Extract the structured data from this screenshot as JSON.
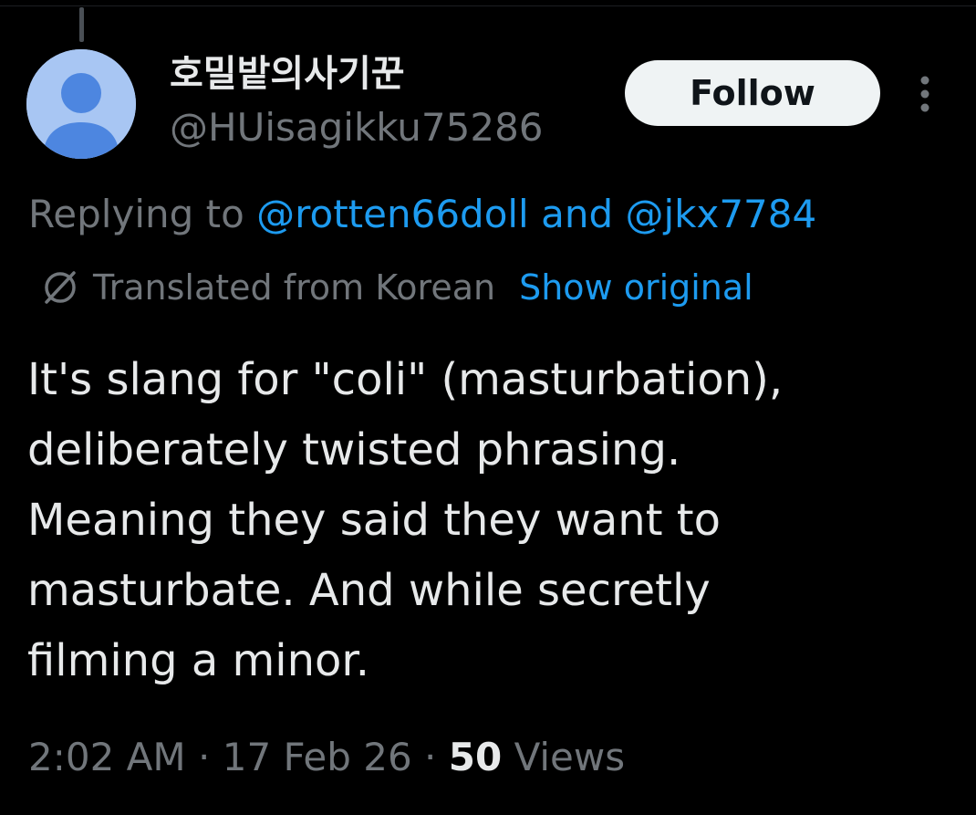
{
  "author": {
    "display_name": "호밀밭의사기꾼",
    "handle": "@HUisagikku75286",
    "avatar_icon": "default-user-avatar-icon",
    "avatar_color": "#a8c6f3"
  },
  "actions": {
    "follow_label": "Follow",
    "more_icon": "more-vertical-icon"
  },
  "reply": {
    "prefix": "Replying to",
    "mentions": [
      "@rotten66doll",
      "@jkx7784"
    ],
    "joiner": "and"
  },
  "translation": {
    "icon": "translate-globe-icon",
    "label": "Translated from Korean",
    "show_original": "Show original"
  },
  "tweet": {
    "lines": [
      "It's slang for \"coli\" (masturbation),",
      "deliberately twisted phrasing.",
      "Meaning they said they want to",
      "masturbate. And while secretly",
      "filming a minor."
    ]
  },
  "meta": {
    "time": "2:02 AM",
    "date": "17 Feb 26",
    "separator": "·",
    "views_count": "50",
    "views_label": "Views"
  },
  "colors": {
    "background": "#000000",
    "primary_text": "#e7e9ea",
    "secondary_text": "#71767b",
    "link": "#1d9bf0",
    "follow_bg": "#eff3f4"
  }
}
